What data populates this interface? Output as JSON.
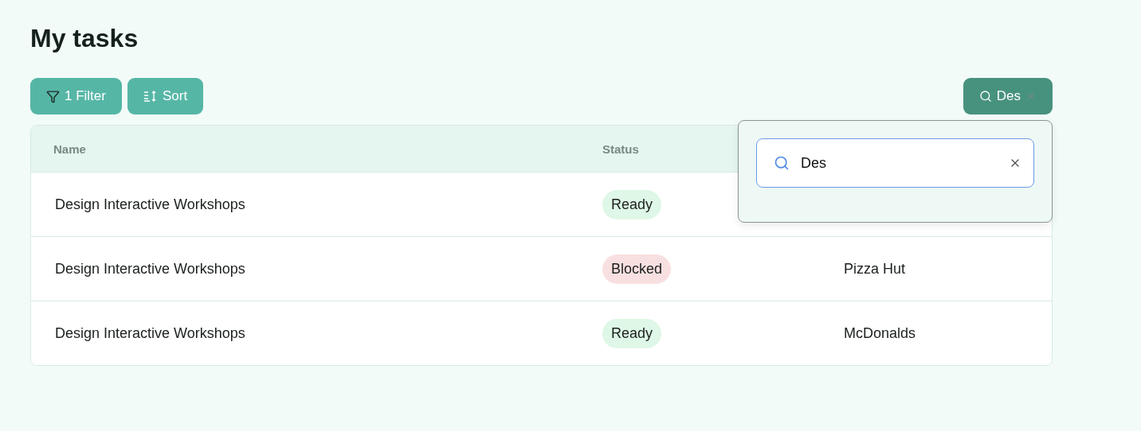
{
  "title": "My tasks",
  "toolbar": {
    "filter_button": "1 Filter",
    "sort_button": "Sort",
    "search_button": "Des"
  },
  "search_popover": {
    "value": "Des"
  },
  "table": {
    "columns": [
      "Name",
      "Status"
    ],
    "rows": [
      {
        "name": "Design Interactive Workshops",
        "status": {
          "label": "Ready",
          "kind": "ready"
        }
      },
      {
        "name": "Design Interactive Workshops",
        "status": {
          "label": "Blocked",
          "kind": "blocked"
        },
        "column_3": "Pizza Hut"
      },
      {
        "name": "Design Interactive Workshops",
        "status": {
          "label": "Ready",
          "kind": "ready"
        },
        "column_3": "McDonalds"
      }
    ]
  }
}
